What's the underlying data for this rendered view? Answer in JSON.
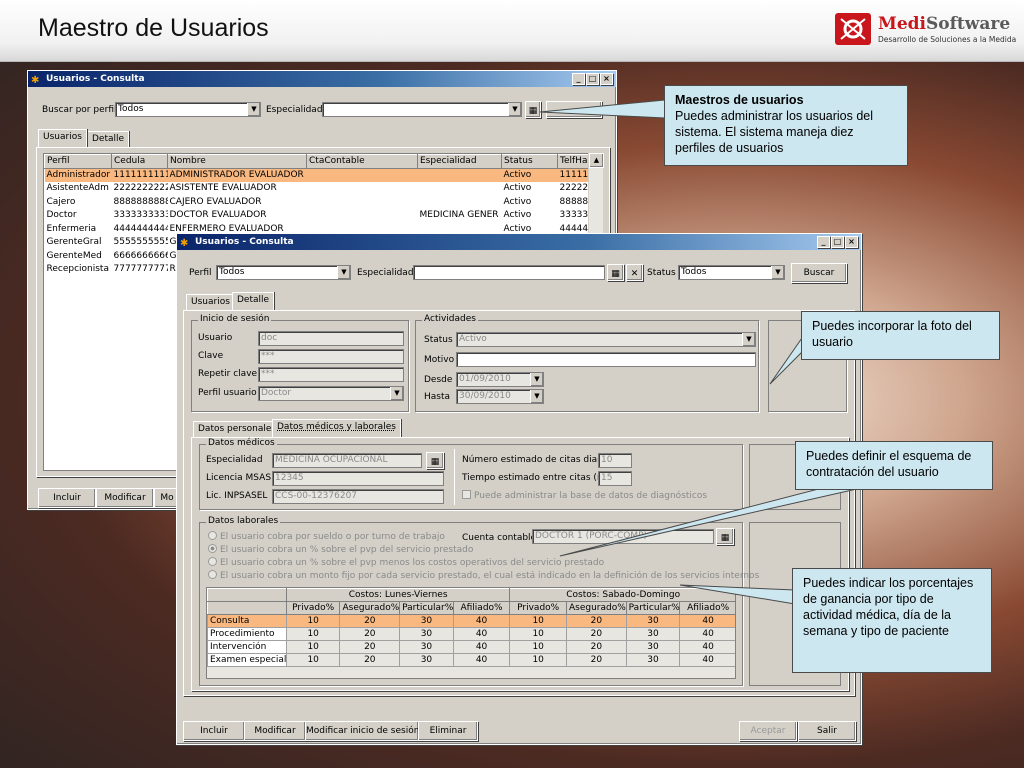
{
  "slide": {
    "title": "Maestro de Usuarios",
    "logo_name_a": "Medi",
    "logo_name_b": "Software",
    "logo_tagline": "Desarrollo de Soluciones a la Medida",
    "brand_color": "#c8161c"
  },
  "window_back": {
    "title": "Usuarios - Consulta",
    "filter_label": "Buscar por perfil",
    "filter_value": "Todos",
    "specialty_label": "Especialidad",
    "specialty_value": "",
    "tabs": [
      "Usuarios",
      "Detalle"
    ],
    "columns": [
      "Perfil",
      "Cedula",
      "Nombre",
      "CtaContable",
      "Especialidad",
      "Status",
      "TelfHabita"
    ],
    "rows": [
      [
        "Administrador",
        "1111111111",
        "ADMINISTRADOR EVALUADOR",
        "",
        "",
        "Activo",
        "11111111"
      ],
      [
        "AsistenteAdm",
        "2222222222",
        "ASISTENTE EVALUADOR",
        "",
        "",
        "Activo",
        "22222222"
      ],
      [
        "Cajero",
        "8888888888",
        "CAJERO EVALUADOR",
        "",
        "",
        "Activo",
        "88888888"
      ],
      [
        "Doctor",
        "3333333333",
        "DOCTOR EVALUADOR",
        "",
        "MEDICINA GENER",
        "Activo",
        "33333333"
      ],
      [
        "Enfermeria",
        "4444444444",
        "ENFERMERO EVALUADOR",
        "",
        "",
        "Activo",
        "44444444"
      ],
      [
        "GerenteGral",
        "5555555555",
        "G",
        "",
        "",
        "",
        ""
      ],
      [
        "GerenteMed",
        "6666666666",
        "G",
        "",
        "",
        "",
        ""
      ],
      [
        "Recepcionista",
        "7777777777",
        "R",
        "",
        "",
        "",
        ""
      ]
    ],
    "buttons": [
      "Incluir",
      "Modificar",
      "Mo"
    ]
  },
  "window_front": {
    "title": "Usuarios - Consulta",
    "perfil_label": "Perfil",
    "perfil_value": "Todos",
    "specialty_label": "Especialidad",
    "specialty_value": "",
    "status_label": "Status",
    "status_value": "Todos",
    "search_button": "Buscar",
    "tabs": [
      "Usuarios",
      "Detalle"
    ],
    "login_group": {
      "title": "Inicio de sesión",
      "usuario_label": "Usuario",
      "usuario_value": "doc",
      "clave_label": "Clave",
      "clave_value": "***",
      "repetir_label": "Repetir clave",
      "repetir_value": "***",
      "perfil_label": "Perfil usuario",
      "perfil_value": "Doctor"
    },
    "activity_group": {
      "title": "Actividades",
      "status_label": "Status",
      "status_value": "Activo",
      "motivo_label": "Motivo",
      "motivo_value": "",
      "desde_label": "Desde",
      "desde_value": "01/09/2010",
      "hasta_label": "Hasta",
      "hasta_value": "30/09/2010"
    },
    "subtabs": [
      "Datos personales",
      "Datos médicos y laborales"
    ],
    "medical_group": {
      "title": "Datos médicos",
      "especialidad_label": "Especialidad",
      "especialidad_value": "MEDICINA OCUPACIONAL",
      "licencia_label": "Licencia MSAS",
      "licencia_value": "12345",
      "inpsasel_label": "Lic. INPSASEL",
      "inpsasel_value": "CCS-00-12376207",
      "citas_label": "Número estimado de citas diarias",
      "citas_value": "10",
      "tiempo_label": "Tiempo estimado entre citas (min)",
      "tiempo_value": "15",
      "admin_check": "Puede administrar la base de datos de diagnósticos"
    },
    "labor_group": {
      "title": "Datos laborales",
      "options": [
        "El usuario cobra por sueldo o por turno de trabajo",
        "El usuario cobra un % sobre el pvp del servicio prestado",
        "El usuario cobra un % sobre el pvp menos los costos operativos del servicio prestado",
        "El usuario cobra un monto fijo por cada servicio prestado, el cual está indicado en la definición de los servicios internos"
      ],
      "cuenta_label": "Cuenta contable",
      "cuenta_value": "DOCTOR 1 (PORC-COMP)"
    },
    "costs": {
      "group_a": "Costos: Lunes-Viernes",
      "group_b": "Costos: Sabado-Domingo",
      "columns": [
        "Privado%",
        "Asegurado%",
        "Particular%",
        "Afiliado%",
        "Privado%",
        "Asegurado%",
        "Particular%",
        "Afiliado%"
      ],
      "rows": [
        {
          "name": "Consulta",
          "values": [
            "10",
            "20",
            "30",
            "40",
            "10",
            "20",
            "30",
            "40"
          ]
        },
        {
          "name": "Procedimiento",
          "values": [
            "10",
            "20",
            "30",
            "40",
            "10",
            "20",
            "30",
            "40"
          ]
        },
        {
          "name": "Intervención",
          "values": [
            "10",
            "20",
            "30",
            "40",
            "10",
            "20",
            "30",
            "40"
          ]
        },
        {
          "name": "Examen especial",
          "values": [
            "10",
            "20",
            "30",
            "40",
            "10",
            "20",
            "30",
            "40"
          ]
        }
      ]
    },
    "bottom_buttons": {
      "incluir": "Incluir",
      "modificar": "Modificar",
      "modificar_sesion": "Modificar inicio de sesión",
      "eliminar": "Eliminar",
      "aceptar": "Aceptar",
      "salir": "Salir"
    }
  },
  "callouts": {
    "c1_title": "Maestros de usuarios",
    "c1_body": "Puedes administrar los usuarios del sistema. El sistema maneja diez perfiles de usuarios",
    "c2": "Puedes incorporar la foto del usuario",
    "c3": "Puedes definir el esquema de contratación del usuario",
    "c4": "Puedes indicar los porcentajes de ganancia por tipo de actividad médica, día de la semana y tipo de paciente"
  }
}
